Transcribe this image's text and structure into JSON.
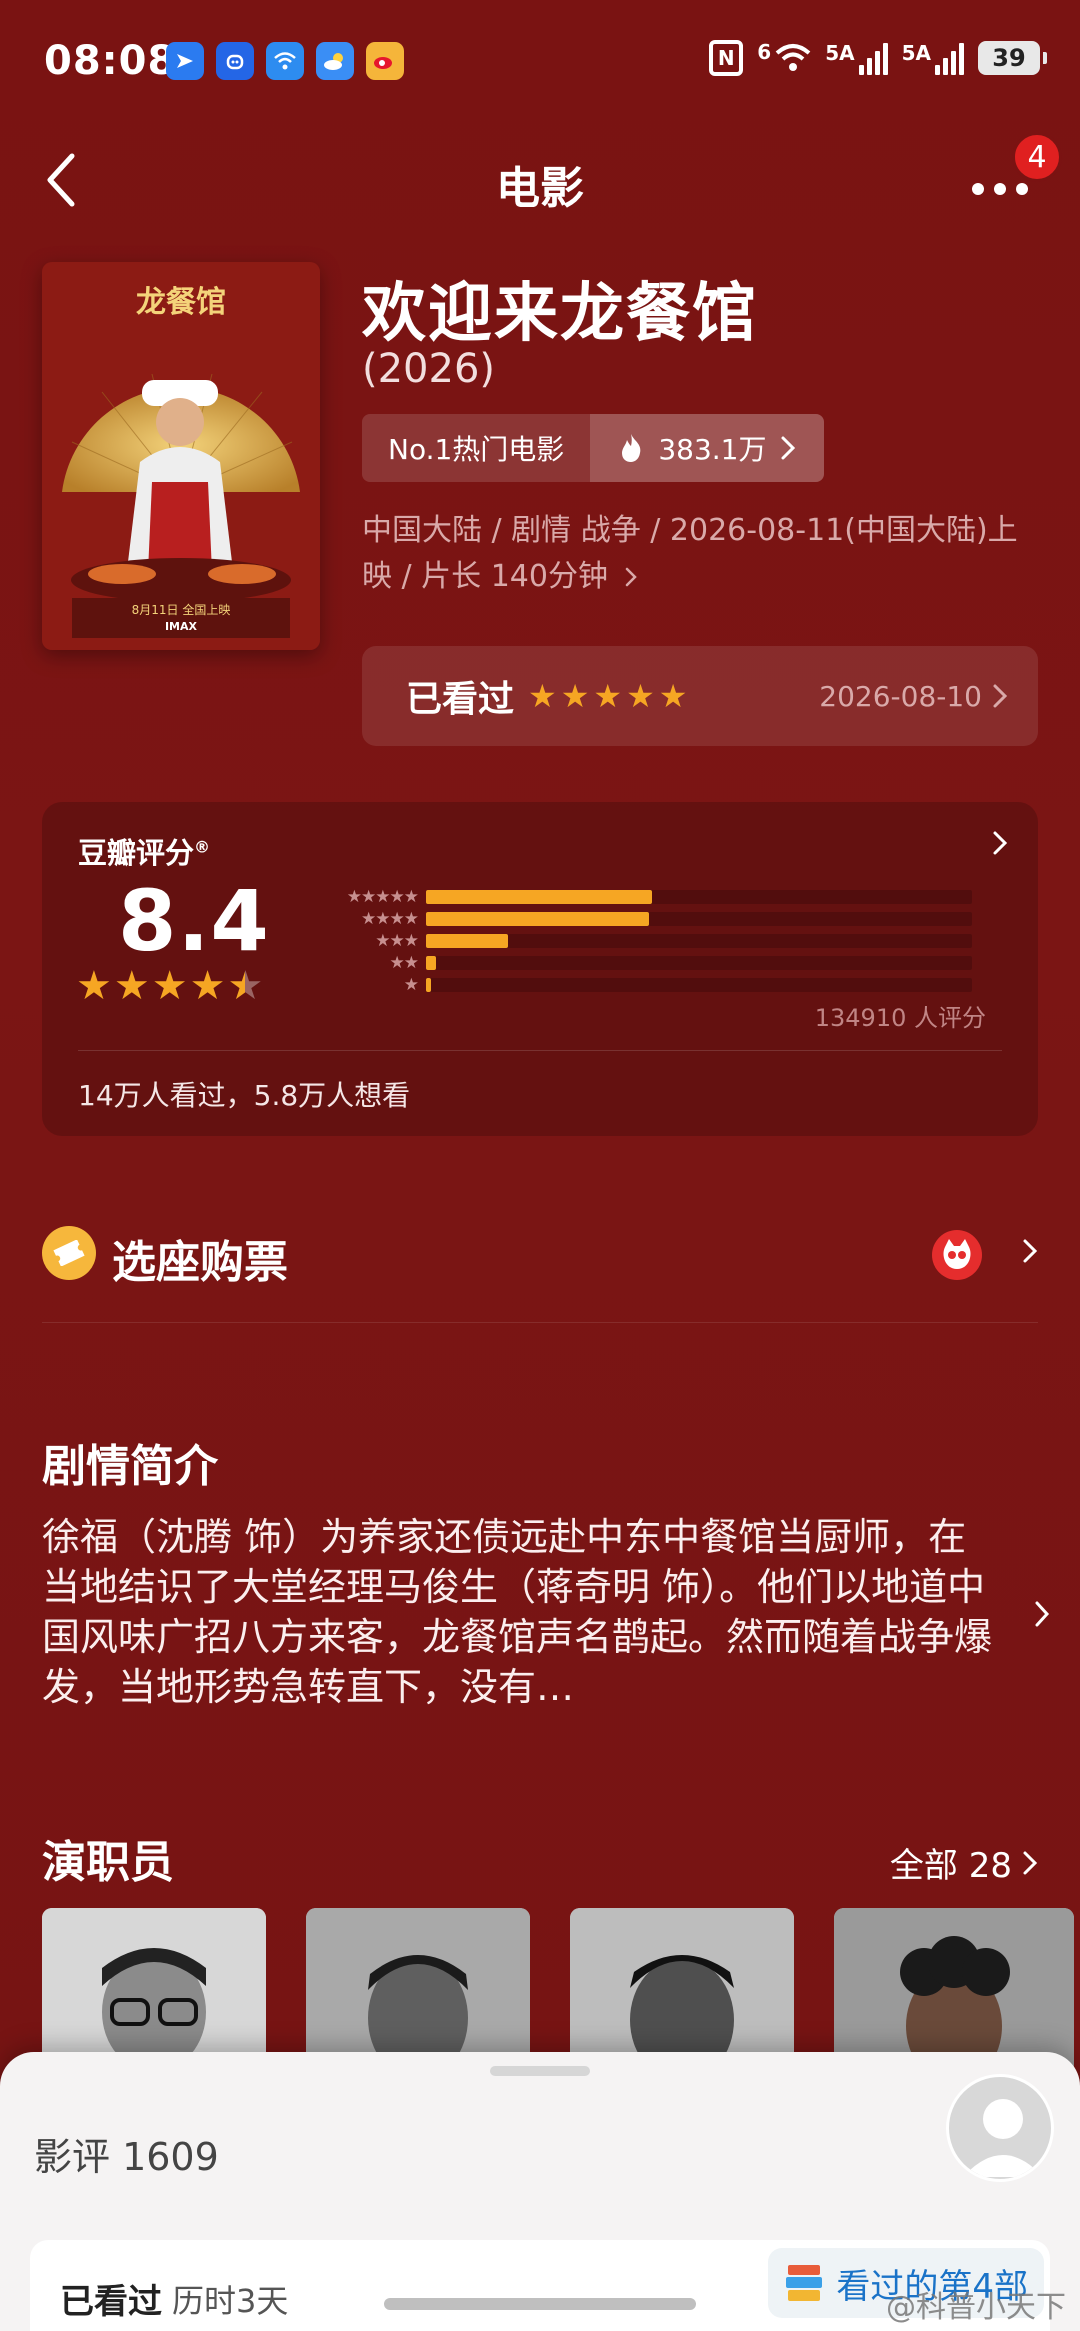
{
  "status_bar": {
    "time": "08:08",
    "network_1": "6",
    "network_2": "5A",
    "network_3": "5A",
    "battery": "39"
  },
  "nav": {
    "title": "电影",
    "badge_count": "4"
  },
  "movie": {
    "title": "欢迎来龙餐馆",
    "year": "(2026)",
    "rank_label": "No.1热门电影",
    "heat": "383.1万",
    "meta": "中国大陆 / 剧情 战争 / 2026-08-11(中国大陆)上映 / 片长 140分钟",
    "seen_label": "已看过",
    "seen_rating": 5,
    "seen_date": "2026-08-10"
  },
  "rating": {
    "brand": "豆瓣评分",
    "brand_mark": "®",
    "score": "8.4",
    "stars": 4.5,
    "distribution": [
      {
        "stars": "★★★★★",
        "percent": 41.4
      },
      {
        "stars": "★★★★",
        "percent": 40.9
      },
      {
        "stars": "★★★",
        "percent": 15.0
      },
      {
        "stars": "★★",
        "percent": 1.8
      },
      {
        "stars": "★",
        "percent": 0.9
      }
    ],
    "count": "134910 人评分",
    "watched_summary": "14万人看过，5.8万人想看"
  },
  "ticket": {
    "label": "选座购票"
  },
  "synopsis": {
    "title": "剧情简介",
    "text": "徐福（沈腾 饰）为养家还债远赴中东中餐馆当厨师，在当地结识了大堂经理马俊生（蒋奇明 饰）。他们以地道中国风味广招八方来客，龙餐馆声名鹊起。然而随着战争爆发，当地形势急转直下，没有…"
  },
  "cast": {
    "title": "演职员",
    "all_label": "全部 28"
  },
  "reviews": {
    "title": "影评 1609",
    "seen_label": "已看过",
    "duration": "历时3天",
    "badge": "看过的第4部"
  },
  "watermark": "@科普小天下",
  "colors": {
    "background": "#7a1312",
    "accent_star": "#f6a623",
    "badge_red": "#e02020",
    "link_blue": "#1a73c8"
  },
  "icons": [
    "back-icon",
    "more-icon",
    "fire-icon",
    "chevron-right-icon",
    "ticket-icon",
    "maoyan-icon",
    "avatar-icon",
    "book-stack-icon"
  ]
}
